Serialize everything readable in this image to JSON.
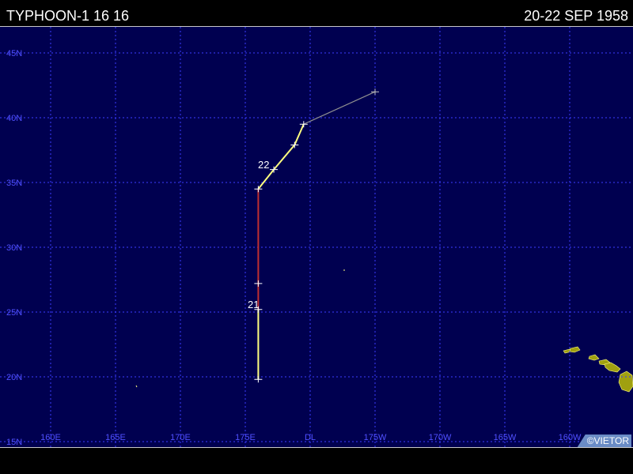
{
  "header": {
    "storm_name": "TYPHOON-1 16 16",
    "date_range": "20-22 SEP 1958"
  },
  "map": {
    "lat_labels": [
      "45N",
      "40N",
      "35N",
      "30N",
      "25N",
      "20N",
      "15N"
    ],
    "lon_labels": [
      "160E",
      "165E",
      "170E",
      "175E",
      "DL",
      "175W",
      "170W",
      "165W",
      "160W"
    ],
    "day_labels": [
      "22",
      "21"
    ],
    "colors": {
      "background": "#000050",
      "grid": "#3c3cff",
      "tropical_storm": "#ffff80",
      "typhoon": "#c03030",
      "extratropical": "#909090",
      "land": "#a0a010"
    },
    "track": [
      {
        "lon": 176.0,
        "lat": 19.8,
        "category": "tropical_storm"
      },
      {
        "lon": 176.0,
        "lat": 25.2,
        "category": "tropical_storm"
      },
      {
        "lon": 176.0,
        "lat": 27.2,
        "category": "typhoon"
      },
      {
        "lon": 176.0,
        "lat": 34.5,
        "category": "typhoon"
      },
      {
        "lon": 177.2,
        "lat": 36.0,
        "category": "tropical_storm"
      },
      {
        "lon": 178.8,
        "lat": 37.9,
        "category": "tropical_storm"
      },
      {
        "lon": 179.5,
        "lat": 39.5,
        "category": "tropical_storm"
      },
      {
        "lon": 185.0,
        "lat": 42.0,
        "category": "extratropical"
      }
    ]
  },
  "credit": "©VIETOR"
}
